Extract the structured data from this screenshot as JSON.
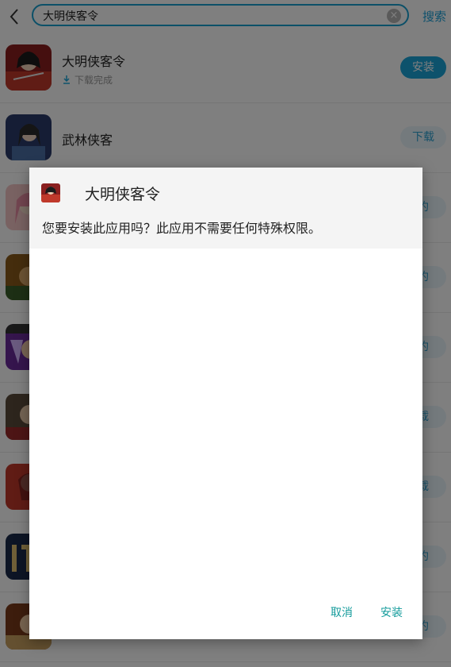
{
  "search": {
    "query": "大明侠客令",
    "button_label": "搜索"
  },
  "app_list": [
    {
      "name": "大明侠客令",
      "status": "下载完成",
      "action": "安装"
    },
    {
      "name": "武林侠客",
      "action": "下载"
    },
    {
      "action": "约"
    },
    {
      "action": "约"
    },
    {
      "action": "约"
    },
    {
      "action": "载"
    },
    {
      "action": "载"
    },
    {
      "action": "约"
    },
    {
      "action": "约"
    }
  ],
  "dialog": {
    "title": "大明侠客令",
    "message": "您要安装此应用吗？此应用不需要任何特殊权限。",
    "cancel_label": "取消",
    "install_label": "安装"
  },
  "colors": {
    "accent": "#1aa5d8",
    "dialog_button": "#139b9b"
  }
}
